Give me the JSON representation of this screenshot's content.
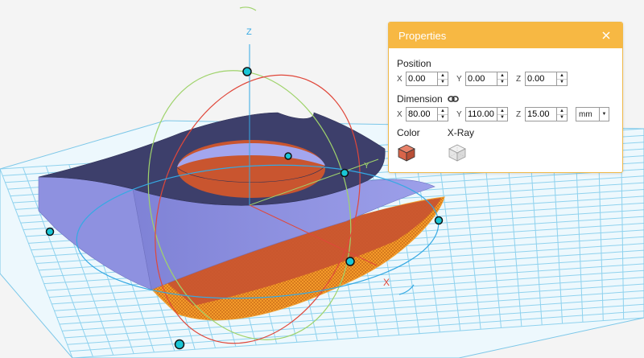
{
  "viewport": {
    "axis_z_label": "Z",
    "axis_y_label": "Y",
    "axis_x_label": "X"
  },
  "properties": {
    "title": "Properties",
    "position": {
      "label": "Position",
      "x_label": "X",
      "x_value": "0.00",
      "y_label": "Y",
      "y_value": "0.00",
      "z_label": "Z",
      "z_value": "0.00"
    },
    "dimension": {
      "label": "Dimension",
      "x_label": "X",
      "x_value": "80.00",
      "y_label": "Y",
      "y_value": "110.00",
      "z_label": "Z",
      "z_value": "15.00",
      "unit": "mm"
    },
    "color": {
      "label": "Color",
      "value": "#d9654a"
    },
    "xray": {
      "label": "X-Ray"
    }
  },
  "colors": {
    "header": "#f7b843",
    "grid": "#8fd2ee",
    "model_top": "#3d3f6b",
    "model_side": "#8f92e0",
    "model_base": "#c9552f",
    "gizmo_handle": "#19c6d6"
  },
  "icons": [
    "close-icon",
    "link-icon",
    "color-cube-icon",
    "xray-cube-icon",
    "rotate-arrow-icon"
  ]
}
